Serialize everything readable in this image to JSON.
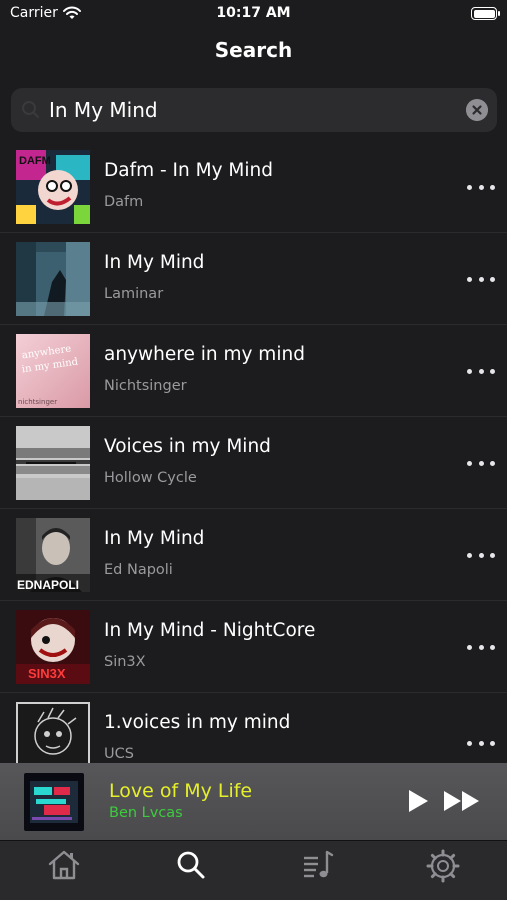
{
  "status_bar": {
    "carrier": "Carrier",
    "time": "10:17 AM"
  },
  "nav": {
    "title": "Search"
  },
  "search": {
    "query": "In My Mind"
  },
  "results": [
    {
      "title": "Dafm - In My Mind",
      "artist": "Dafm"
    },
    {
      "title": "In My Mind",
      "artist": "Laminar"
    },
    {
      "title": "anywhere in my mind",
      "artist": "Nichtsinger"
    },
    {
      "title": "Voices in my Mind",
      "artist": "Hollow Cycle"
    },
    {
      "title": "In My Mind",
      "artist": "Ed Napoli"
    },
    {
      "title": "In My Mind - NightCore",
      "artist": "Sin3X"
    },
    {
      "title": "1.voices in my mind",
      "artist": "UCS"
    }
  ],
  "artwork_text": {
    "nichtsinger_top": "anywhere",
    "nichtsinger_mid": "in my mind",
    "nichtsinger_bottom": "nichtsinger",
    "ednapoli": "EDNAPOLI",
    "sin3x": "SIN3X",
    "dafm": "DAFM"
  },
  "now_playing": {
    "title": "Love of My Life",
    "artist": "Ben Lvcas"
  },
  "tabs": [
    {
      "name": "home",
      "icon": "home-icon",
      "active": false
    },
    {
      "name": "search",
      "icon": "search-icon",
      "active": true
    },
    {
      "name": "library",
      "icon": "playlist-icon",
      "active": false
    },
    {
      "name": "settings",
      "icon": "gear-icon",
      "active": false
    }
  ],
  "colors": {
    "background": "#1c1c1e",
    "now_playing_title": "#e6f02a",
    "now_playing_artist": "#3ccd3c",
    "inactive_tab": "#8e8e93",
    "active_tab": "#ffffff"
  }
}
